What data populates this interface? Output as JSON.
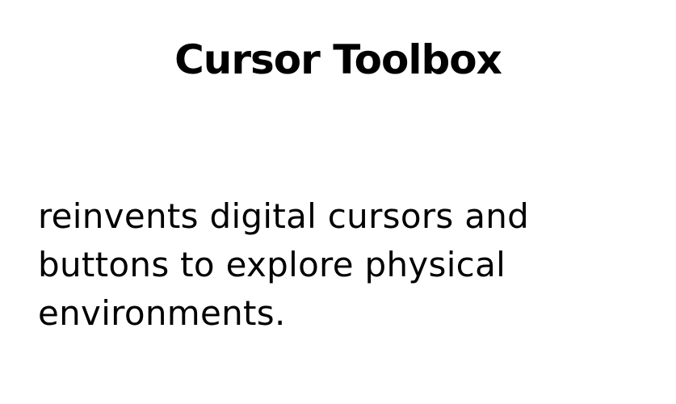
{
  "slide": {
    "title": "Cursor Toolbox",
    "body": "reinvents digital cursors and buttons to explore physical environments."
  }
}
